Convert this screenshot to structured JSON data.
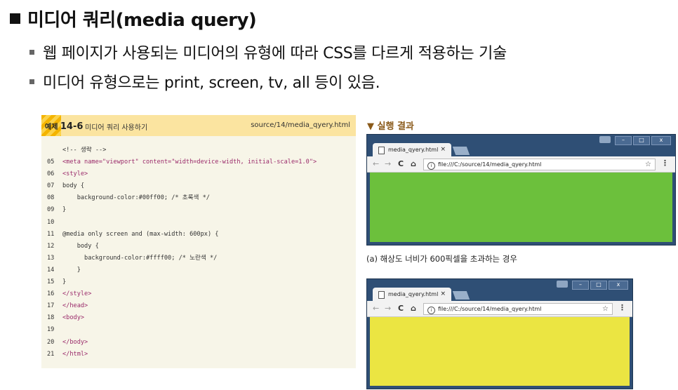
{
  "heading": "미디어 쿼리(media query)",
  "bullets": [
    "웹 페이지가 사용되는 미디어의 유형에 따라 CSS를 다르게 적용하는 기술",
    "미디어 유형으로는 print, screen, tv, all 등이 있음."
  ],
  "example": {
    "label": "예제",
    "number": "14-6",
    "title": "미디어 쿼리 사용하기",
    "source": "source/14/media_qyery.html",
    "code_lines": [
      {
        "n": "",
        "text": "<!-- 생략 -->"
      },
      {
        "n": "05",
        "text": "<meta name=\"viewport\" content=\"width=device-width, initial-scale=1.0\">"
      },
      {
        "n": "06",
        "text": "<style>"
      },
      {
        "n": "07",
        "text": "body {"
      },
      {
        "n": "08",
        "text": "    background-color:#00ff00; /* 초록색 */"
      },
      {
        "n": "09",
        "text": "}"
      },
      {
        "n": "10",
        "text": ""
      },
      {
        "n": "11",
        "text": "@media only screen and (max-width: 600px) {"
      },
      {
        "n": "12",
        "text": "    body {"
      },
      {
        "n": "13",
        "text": "      background-color:#ffff00; /* 노란색 */"
      },
      {
        "n": "14",
        "text": "    }"
      },
      {
        "n": "15",
        "text": "}"
      },
      {
        "n": "16",
        "text": "</style>"
      },
      {
        "n": "17",
        "text": "</head>"
      },
      {
        "n": "18",
        "text": "<body>"
      },
      {
        "n": "19",
        "text": ""
      },
      {
        "n": "20",
        "text": "</body>"
      },
      {
        "n": "21",
        "text": "</html>"
      }
    ]
  },
  "result_label": "▼ 실행 결과",
  "caption": "(a) 해상도 너비가 600픽셀을 초과하는 경우",
  "browsers": [
    {
      "tab_title": "media_qyery.html",
      "tab_close": "×",
      "url": "file:///C:/source/14/media_qyery.html",
      "page_color": "#6cc03c",
      "min": "–",
      "max": "□",
      "close": "x"
    },
    {
      "tab_title": "media_qyery.html",
      "tab_close": "×",
      "url": "file:///C:/source/14/media_qyery.html",
      "page_color": "#ebe542",
      "min": "–",
      "max": "□",
      "close": "x"
    }
  ],
  "nav_icons": {
    "back": "←",
    "forward": "→",
    "reload": "C",
    "home": "⌂",
    "info": "i",
    "star": "☆",
    "menu": "⋮"
  }
}
